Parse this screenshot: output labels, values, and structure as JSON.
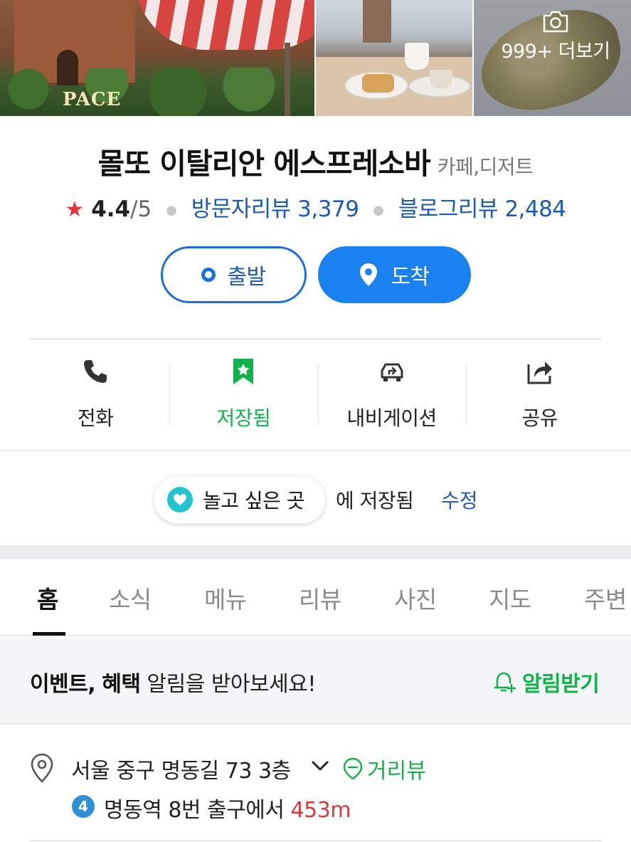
{
  "photos": {
    "logo_text": "PACE",
    "more_label": "999+ 더보기",
    "icons": {
      "camera": "camera-icon"
    }
  },
  "place": {
    "name": "몰또 이탈리안 에스프레소바",
    "category": "카페,디저트",
    "rating_score": "4.4",
    "rating_max": "/5",
    "visitor_reviews": "방문자리뷰 3,379",
    "blog_reviews": "블로그리뷰 2,484"
  },
  "route": {
    "start_label": "출발",
    "end_label": "도착"
  },
  "actions": [
    {
      "label": "전화",
      "icon": "phone-icon"
    },
    {
      "label": "저장됨",
      "icon": "bookmark-icon"
    },
    {
      "label": "내비게이션",
      "icon": "car-navigation-icon"
    },
    {
      "label": "공유",
      "icon": "share-icon"
    }
  ],
  "saved": {
    "list_name": "놀고 싶은 곳",
    "status": "에 저장됨",
    "edit_label": "수정"
  },
  "tabs": [
    "홈",
    "소식",
    "메뉴",
    "리뷰",
    "사진",
    "지도",
    "주변"
  ],
  "active_tab": "홈",
  "notice": {
    "bold1": "이벤트,",
    "bold2": "혜택",
    "rest": "알림을 받아보세요!",
    "button_label": "알림받기"
  },
  "address": {
    "text": "서울 중구 명동길 73 3층",
    "street_view": "거리뷰",
    "subway_line": "4",
    "station": "명동역 8번 출구에서",
    "distance": "453m"
  },
  "colors": {
    "accent_blue": "#1a82f0",
    "link_blue": "#1a5ab8",
    "green": "#12b24a",
    "star_red": "#e8343b",
    "line4_blue": "#2f8fd6"
  }
}
